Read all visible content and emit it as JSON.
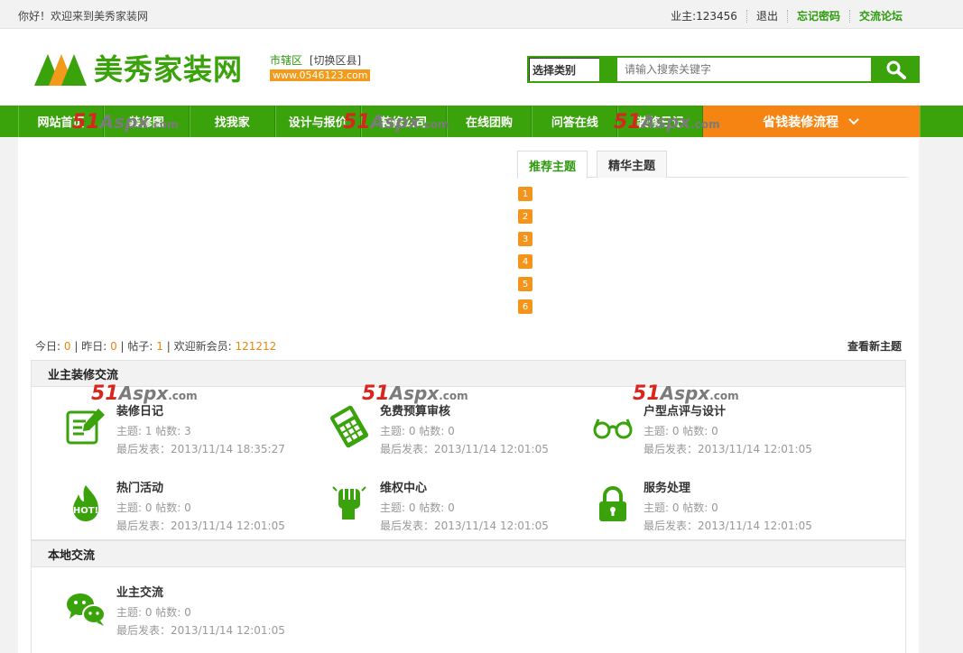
{
  "topbar": {
    "welcome": "你好！欢迎来到美秀家装网",
    "user": "业主:123456",
    "logout": "退出",
    "forgot": "忘记密码",
    "forum": "交流论坛"
  },
  "header": {
    "brand": "美秀家装网",
    "city": "市辖区",
    "switch": "[切换区县]",
    "url": "www.0546123.com"
  },
  "search": {
    "category": "选择类别",
    "placeholder": "请输入搜索关键字"
  },
  "nav": {
    "items": [
      "网站首页",
      "装修图",
      "找我家",
      "设计与报价",
      "装修公司",
      "在线团购",
      "问答在线",
      "装修日记"
    ],
    "highlight": "省钱装修流程"
  },
  "watermark": {
    "num": "51",
    "text": "Aspx",
    "suffix": ".com"
  },
  "tabs": [
    "推荐主题",
    "精华主题"
  ],
  "ranks": [
    "1",
    "2",
    "3",
    "4",
    "5",
    "6"
  ],
  "stats": {
    "today_label": "今日:",
    "today": "0",
    "yesterday_label": "昨日:",
    "yesterday": "0",
    "posts_label": "帖子:",
    "posts": "1",
    "newmember_label": "欢迎新会员:",
    "newmember": "121212",
    "newtopic": "查看新主题"
  },
  "sections": [
    {
      "title": "业主装修交流",
      "forums": [
        {
          "name": "装修日记",
          "icon": "diary-icon",
          "stats": "主题: 1 帖数: 3",
          "last": "最后发表：2013/11/14 18:35:27"
        },
        {
          "name": "免费预算审核",
          "icon": "calculator-icon",
          "stats": "主题: 0 帖数: 0",
          "last": "最后发表：2013/11/14 12:01:05"
        },
        {
          "name": "户型点评与设计",
          "icon": "glasses-icon",
          "stats": "主题: 0 帖数: 0",
          "last": "最后发表：2013/11/14 12:01:05"
        },
        {
          "name": "热门活动",
          "icon": "hot-fire-icon",
          "stats": "主题: 0 帖数: 0",
          "last": "最后发表：2013/11/14 12:01:05"
        },
        {
          "name": "维权中心",
          "icon": "fist-icon",
          "stats": "主题: 0 帖数: 0",
          "last": "最后发表：2013/11/14 12:01:05"
        },
        {
          "name": "服务处理",
          "icon": "lock-icon",
          "stats": "主题: 0 帖数: 0",
          "last": "最后发表：2013/11/14 12:01:05"
        }
      ]
    },
    {
      "title": "本地交流",
      "forums": [
        {
          "name": "业主交流",
          "icon": "chat-icon",
          "stats": "主题: 0 帖数: 0",
          "last": "最后发表：2013/11/14 12:01:05"
        }
      ]
    }
  ],
  "colors": {
    "green": "#3aa20a",
    "orange": "#f58412",
    "badge": "#f3951c"
  }
}
